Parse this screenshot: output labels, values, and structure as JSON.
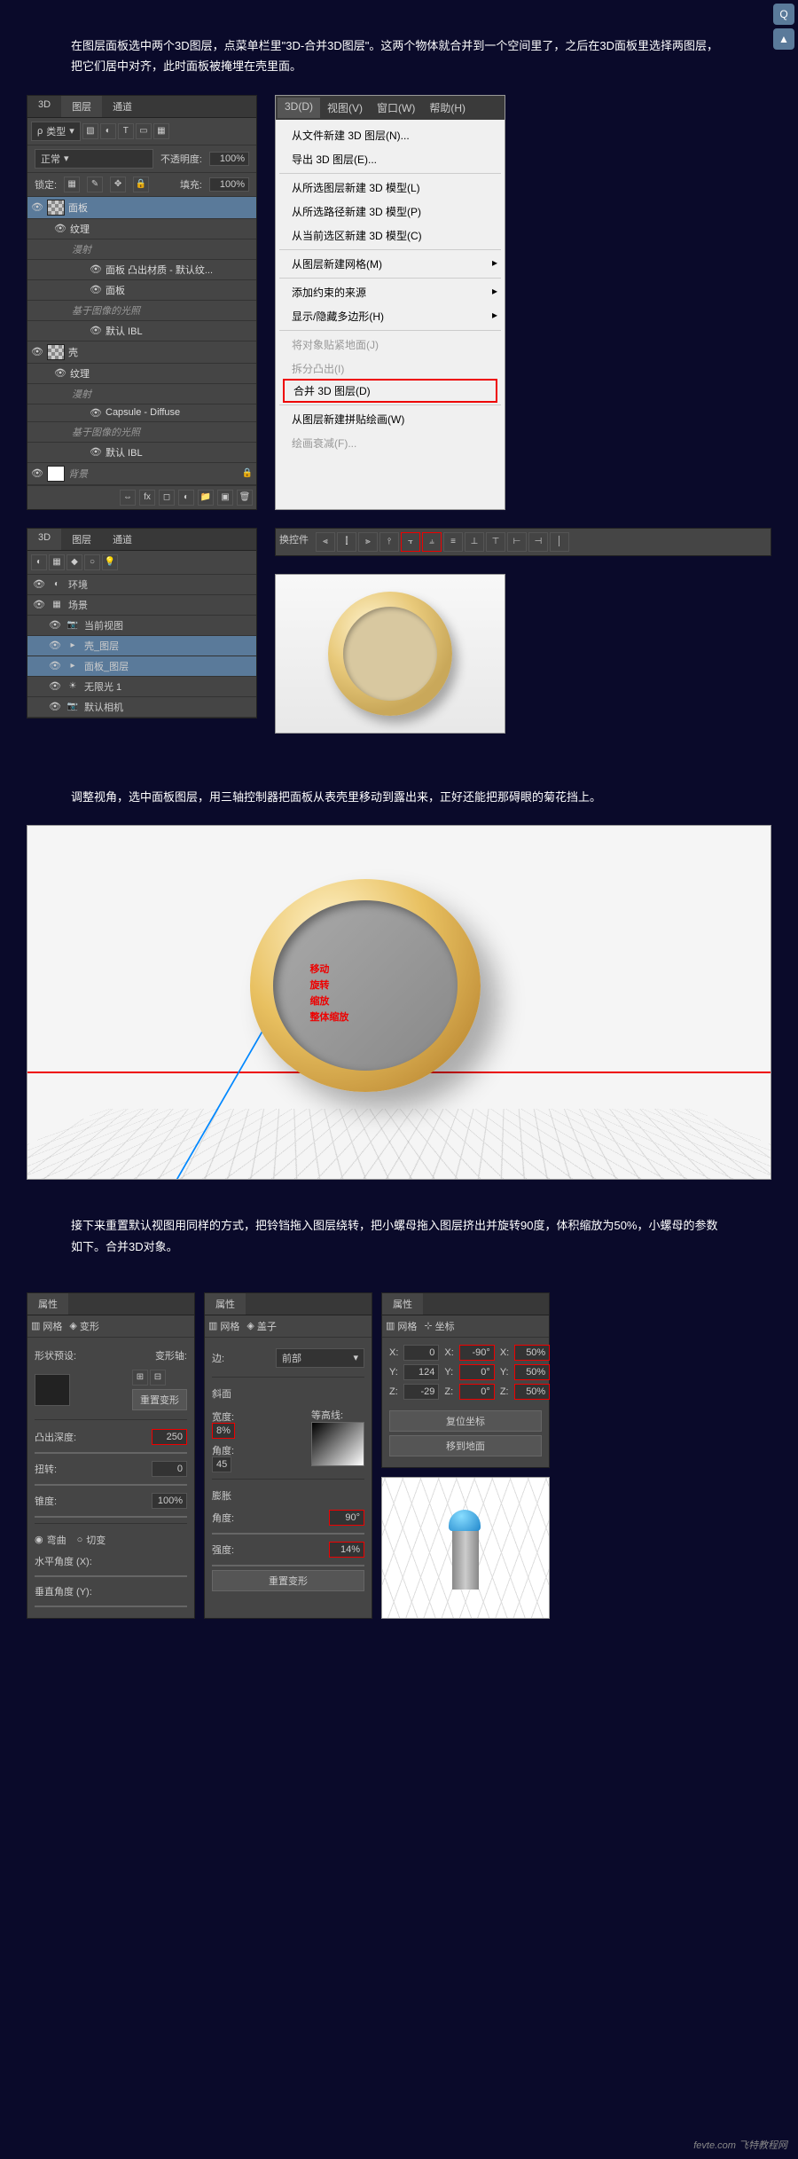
{
  "intro1": "在图层面板选中两个3D图层，点菜单栏里\"3D-合并3D图层\"。这两个物体就合并到一个空间里了，之后在3D面板里选择两图层，把它们居中对齐，此时面板被掩埋在壳里面。",
  "intro2": "调整视角，选中面板图层，用三轴控制器把面板从表壳里移动到露出来，正好还能把那碍眼的菊花挡上。",
  "intro3": "接下来重置默认视图用同样的方式，把铃铛拖入图层绕转，把小螺母拖入图层挤出并旋转90度，体积缩放为50%，小螺母的参数如下。合并3D对象。",
  "layers": {
    "tabs": [
      "3D",
      "图层",
      "通道"
    ],
    "kind_label": "类型",
    "blend_mode": "正常",
    "opacity_label": "不透明度:",
    "opacity": "100%",
    "lock_label": "锁定:",
    "fill_label": "填充:",
    "fill": "100%",
    "items": [
      {
        "name": "面板",
        "selected": true,
        "thumb": true
      },
      {
        "name": "纹理",
        "sub": 1,
        "eye": true
      },
      {
        "name": "漫射",
        "sub": 2,
        "italic": true
      },
      {
        "name": "面板 凸出材质 - 默认纹...",
        "sub": 3,
        "eye": true
      },
      {
        "name": "面板",
        "sub": 3,
        "eye": true
      },
      {
        "name": "基于图像的光照",
        "sub": 2,
        "italic": true
      },
      {
        "name": "默认 IBL",
        "sub": 3,
        "eye": true
      },
      {
        "name": "壳",
        "thumb": true,
        "eye": true
      },
      {
        "name": "纹理",
        "sub": 1,
        "eye": true
      },
      {
        "name": "漫射",
        "sub": 2,
        "italic": true
      },
      {
        "name": "Capsule - Diffuse",
        "sub": 3,
        "eye": true
      },
      {
        "name": "基于图像的光照",
        "sub": 2,
        "italic": true
      },
      {
        "name": "默认 IBL",
        "sub": 3,
        "eye": true
      },
      {
        "name": "背景",
        "thumb": true,
        "eye": true,
        "locked": true,
        "italic": true
      }
    ]
  },
  "menu": {
    "bar": [
      "3D(D)",
      "视图(V)",
      "窗口(W)",
      "帮助(H)"
    ],
    "items": [
      {
        "label": "从文件新建 3D 图层(N)...",
        "type": "item"
      },
      {
        "label": "导出 3D 图层(E)...",
        "type": "item"
      },
      {
        "type": "sep"
      },
      {
        "label": "从所选图层新建 3D 模型(L)",
        "type": "item"
      },
      {
        "label": "从所选路径新建 3D 模型(P)",
        "type": "item"
      },
      {
        "label": "从当前选区新建 3D 模型(C)",
        "type": "item"
      },
      {
        "type": "sep"
      },
      {
        "label": "从图层新建网格(M)",
        "type": "item",
        "sub": true
      },
      {
        "type": "sep"
      },
      {
        "label": "添加约束的来源",
        "type": "item",
        "sub": true
      },
      {
        "label": "显示/隐藏多边形(H)",
        "type": "item",
        "sub": true
      },
      {
        "type": "sep"
      },
      {
        "label": "将对象贴紧地面(J)",
        "type": "item",
        "disabled": true
      },
      {
        "label": "拆分凸出(I)",
        "type": "item",
        "disabled": true
      },
      {
        "label": "合并 3D 图层(D)",
        "type": "item",
        "highlight": true
      },
      {
        "type": "sep"
      },
      {
        "label": "从图层新建拼贴绘画(W)",
        "type": "item"
      },
      {
        "label": "绘画衰减(F)...",
        "type": "item",
        "disabled": true
      }
    ]
  },
  "scene": {
    "tabs": [
      "3D",
      "图层",
      "通道"
    ],
    "filter_icons": [
      "◐",
      "▦",
      "◆",
      "○",
      "💡"
    ],
    "items": [
      {
        "name": "环境",
        "icon": "◐"
      },
      {
        "name": "场景",
        "icon": "▦"
      },
      {
        "name": "当前视图",
        "icon": "📷",
        "indent": 1
      },
      {
        "name": "壳_图层",
        "icon": "▸",
        "indent": 1,
        "selected": true
      },
      {
        "name": "面板_图层",
        "icon": "▸",
        "indent": 1,
        "selected": true
      },
      {
        "name": "无限光 1",
        "icon": "☀",
        "indent": 1
      },
      {
        "name": "默认相机",
        "icon": "📷",
        "indent": 1
      }
    ]
  },
  "align_toolbar_label": "换控件",
  "gizmo": {
    "move": "移动",
    "rotate": "旋转",
    "scale": "缩放",
    "uniform": "整体缩放"
  },
  "props1": {
    "title": "属性",
    "tabs": [
      "网格",
      "变形"
    ],
    "shape_preset": "形状预设:",
    "deform_axis": "变形轴:",
    "reset": "重置变形",
    "extrude_depth": "凸出深度:",
    "extrude_val": "250",
    "twist": "扭转:",
    "twist_val": "0",
    "taper": "锥度:",
    "taper_val": "100%",
    "bend": "弯曲",
    "shear": "切变",
    "h_angle": "水平角度 (X):",
    "v_angle": "垂直角度 (Y):"
  },
  "props2": {
    "title": "属性",
    "tabs": [
      "网格",
      "盖子"
    ],
    "side": "边:",
    "side_val": "前部",
    "bevel": "斜面",
    "width": "宽度:",
    "width_val": "8%",
    "angle": "角度:",
    "angle_val": "45",
    "contour": "等高线:",
    "inflate": "膨胀",
    "inf_angle": "角度:",
    "inf_angle_val": "90°",
    "strength": "强度:",
    "strength_val": "14%",
    "reset": "重置变形"
  },
  "props3": {
    "title": "属性",
    "tabs": [
      "网格",
      "坐标"
    ],
    "coords": {
      "x_pos": "0",
      "x_rot": "-90°",
      "x_scale": "50%",
      "y_pos": "124",
      "y_rot": "0°",
      "y_scale": "50%",
      "z_pos": "-29",
      "z_rot": "0°",
      "z_scale": "50%"
    },
    "reset_coords": "复位坐标",
    "snap_ground": "移到地面"
  },
  "corner": {
    "qq": "Q",
    "top": "▲"
  },
  "watermark": "fevte.com 飞特教程网"
}
